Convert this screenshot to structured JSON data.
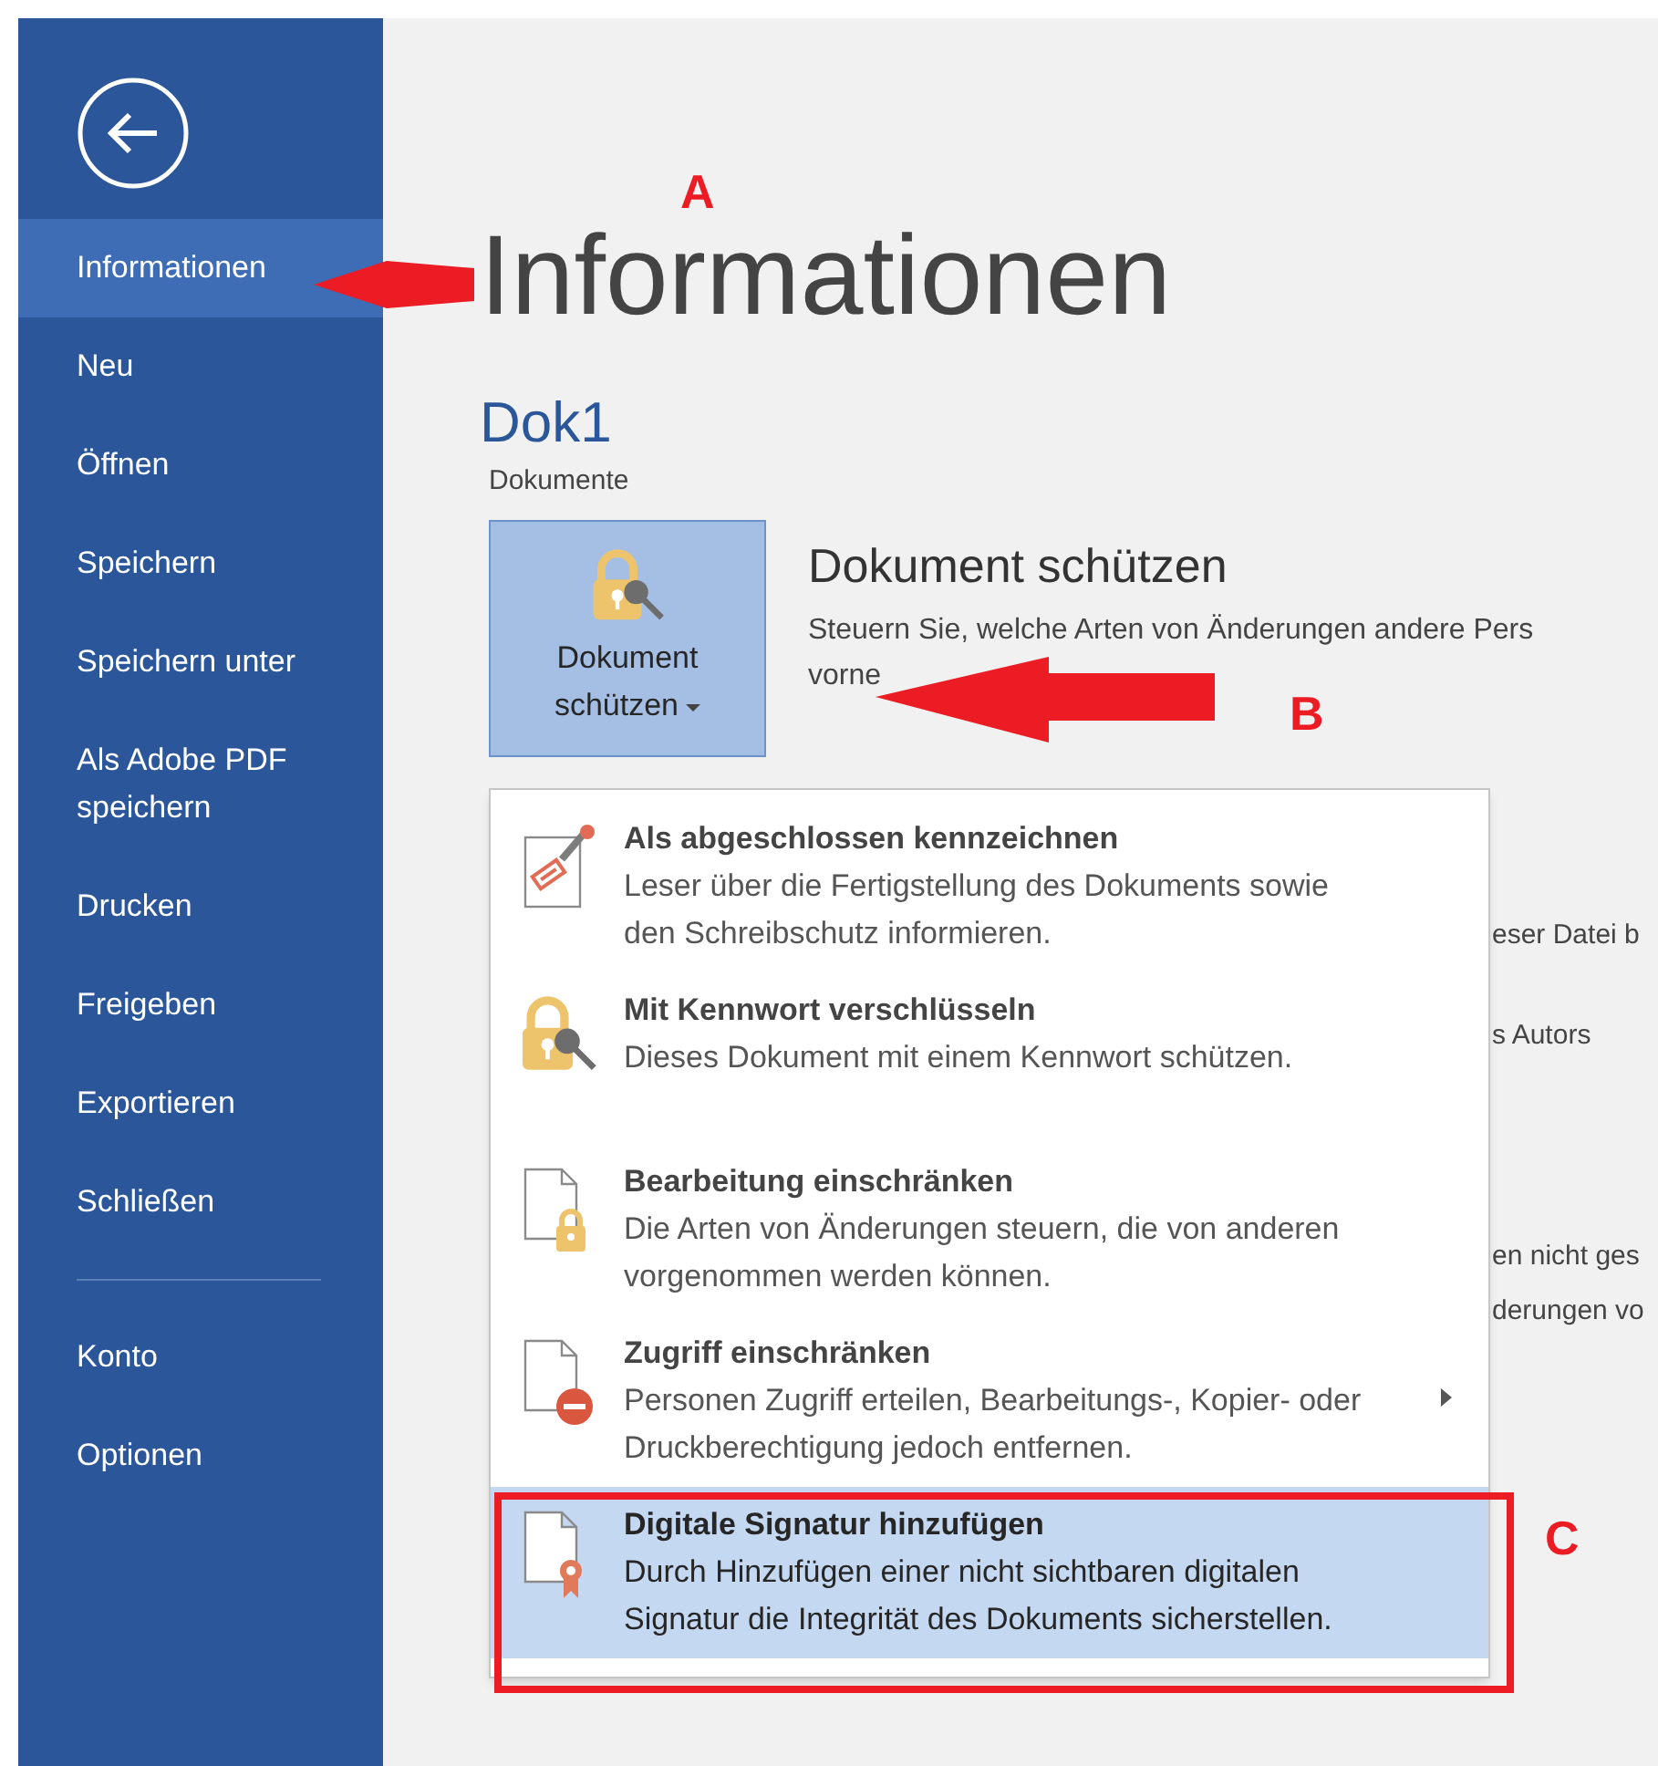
{
  "sidebar": {
    "items": [
      {
        "label": "Informationen",
        "selected": true
      },
      {
        "label": "Neu",
        "selected": false
      },
      {
        "label": "Öffnen",
        "selected": false
      },
      {
        "label": "Speichern",
        "selected": false
      },
      {
        "label": "Speichern unter",
        "selected": false
      },
      {
        "label": "Als Adobe PDF speichern",
        "selected": false
      },
      {
        "label": "Drucken",
        "selected": false
      },
      {
        "label": "Freigeben",
        "selected": false
      },
      {
        "label": "Exportieren",
        "selected": false
      },
      {
        "label": "Schließen",
        "selected": false
      }
    ],
    "footer_items": [
      {
        "label": "Konto",
        "selected": false
      },
      {
        "label": "Optionen",
        "selected": false
      }
    ]
  },
  "page_title": "Informationen",
  "document_name": "Dok1",
  "document_location": "Dokumente",
  "protect": {
    "button_label": "Dokument schützen",
    "heading": "Dokument schützen",
    "description_lines": [
      "Steuern Sie, welche Arten von Änderungen andere Pers",
      "vorne"
    ]
  },
  "background_fragments": [
    "eser Datei b",
    "s Autors",
    "en nicht ges",
    "derungen vo"
  ],
  "menu": {
    "items": [
      {
        "kind": "stamp",
        "title": "Als abgeschlossen kennzeichnen",
        "description": "Leser über die Fertigstellung des Dokuments sowie den Schreibschutz informieren.",
        "selected": false,
        "submenu": false
      },
      {
        "kind": "password",
        "title": "Mit Kennwort verschlüsseln",
        "description": "Dieses Dokument mit einem Kennwort schützen.",
        "selected": false,
        "submenu": false
      },
      {
        "kind": "restrict-edit",
        "title": "Bearbeitung einschränken",
        "description": "Die Arten von Änderungen steuern, die von anderen vorgenommen werden können.",
        "selected": false,
        "submenu": false
      },
      {
        "kind": "restrict-access",
        "title": "Zugriff einschränken",
        "description": "Personen Zugriff erteilen, Bearbeitungs-, Kopier- oder Druckberechtigung jedoch entfernen.",
        "selected": false,
        "submenu": true
      },
      {
        "kind": "signature",
        "title": "Digitale Signatur hinzufügen",
        "description": "Durch Hinzufügen einer nicht sichtbaren digitalen Signatur die Integrität des Dokuments sicherstellen.",
        "selected": true,
        "submenu": false
      }
    ]
  },
  "annotations": [
    {
      "label": "A"
    },
    {
      "label": "B"
    },
    {
      "label": "C"
    }
  ]
}
